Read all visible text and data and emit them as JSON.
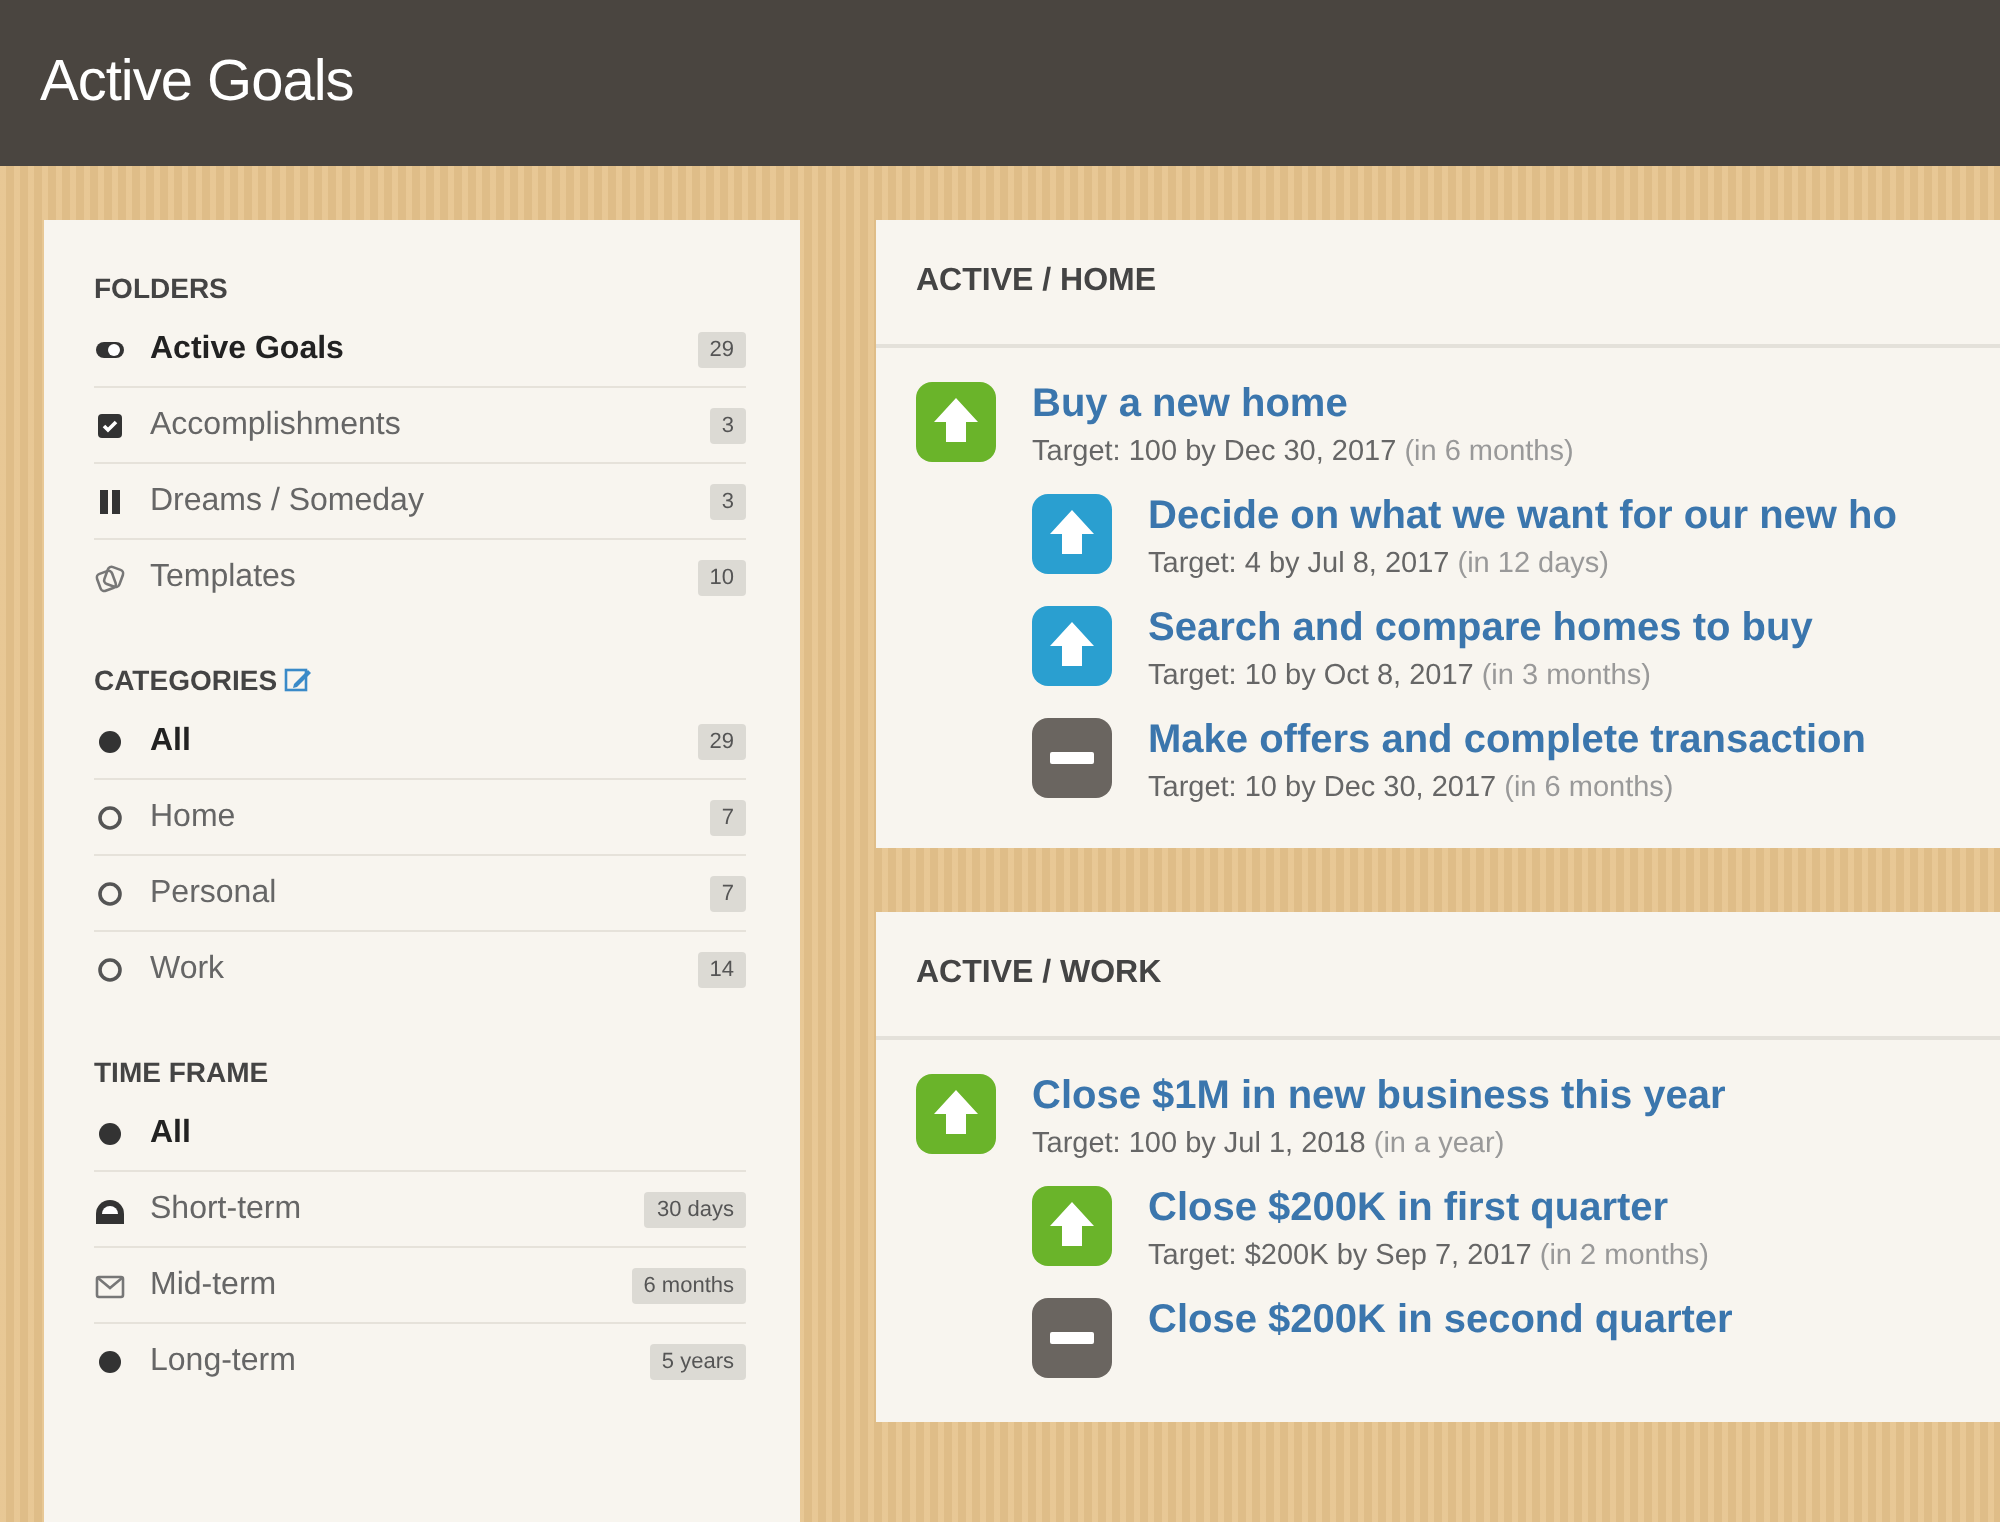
{
  "header": {
    "title": "Active Goals"
  },
  "sidebar": {
    "sections": [
      {
        "heading": "FOLDERS",
        "items": [
          {
            "kind": "toggle",
            "label": "Active Goals",
            "count": "29",
            "selected": true
          },
          {
            "kind": "check",
            "label": "Accomplishments",
            "count": "3",
            "selected": false
          },
          {
            "kind": "pause",
            "label": "Dreams / Someday",
            "count": "3",
            "selected": false
          },
          {
            "kind": "copy",
            "label": "Templates",
            "count": "10",
            "selected": false
          }
        ]
      },
      {
        "heading": "CATEGORIES",
        "editable": true,
        "items": [
          {
            "kind": "radio",
            "label": "All",
            "count": "29",
            "selected": true
          },
          {
            "kind": "radio",
            "label": "Home",
            "count": "7",
            "selected": false
          },
          {
            "kind": "radio",
            "label": "Personal",
            "count": "7",
            "selected": false
          },
          {
            "kind": "radio",
            "label": "Work",
            "count": "14",
            "selected": false
          }
        ]
      },
      {
        "heading": "TIME FRAME",
        "items": [
          {
            "kind": "dot",
            "label": "All",
            "selected": true
          },
          {
            "kind": "dome",
            "label": "Short-term",
            "count": "30 days",
            "selected": false
          },
          {
            "kind": "mail",
            "label": "Mid-term",
            "count": "6 months",
            "selected": false
          },
          {
            "kind": "dot",
            "label": "Long-term",
            "count": "5 years",
            "selected": false
          }
        ]
      }
    ]
  },
  "panels": [
    {
      "heading": "ACTIVE / HOME",
      "goals": [
        {
          "kind": "up",
          "color": "#6ab42a",
          "title": "Buy a new home",
          "target": "Target: 100 by Dec 30, 2017",
          "due": "(in 6 months)",
          "children": [
            {
              "kind": "up",
              "color": "#2a9fd0",
              "title": "Decide on what we want for our new ho",
              "target": "Target: 4 by Jul 8, 2017",
              "due": "(in 12 days)"
            },
            {
              "kind": "up",
              "color": "#2a9fd0",
              "title": "Search and compare homes to buy",
              "target": "Target: 10 by Oct 8, 2017",
              "due": "(in 3 months)"
            },
            {
              "kind": "minus",
              "color": "#6a6560",
              "title": "Make offers and complete transaction",
              "target": "Target: 10 by Dec 30, 2017",
              "due": "(in 6 months)"
            }
          ]
        }
      ]
    },
    {
      "heading": "ACTIVE / WORK",
      "goals": [
        {
          "kind": "up",
          "color": "#6ab42a",
          "title": "Close $1M in new business this year",
          "target": "Target: 100 by Jul 1, 2018",
          "due": "(in a year)",
          "children": [
            {
              "kind": "up",
              "color": "#6ab42a",
              "title": "Close $200K in first quarter",
              "target": "Target: $200K by Sep 7, 2017",
              "due": "(in 2 months)"
            },
            {
              "kind": "minus",
              "color": "#6a6560",
              "title": "Close $200K in second quarter"
            }
          ]
        }
      ]
    }
  ]
}
